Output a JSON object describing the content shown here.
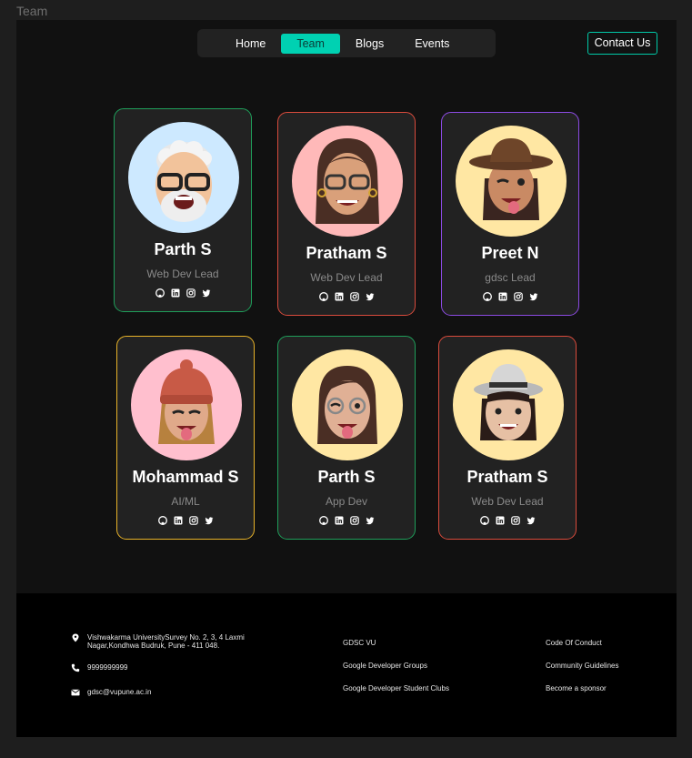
{
  "frame_label": "Team",
  "nav": {
    "items": [
      {
        "label": "Home",
        "active": false
      },
      {
        "label": "Team",
        "active": true
      },
      {
        "label": "Blogs",
        "active": false
      },
      {
        "label": "Events",
        "active": false
      }
    ],
    "contact_label": "Contact Us"
  },
  "accent_color": "#00d1b2",
  "members": [
    {
      "name": "Parth S",
      "role": "Web Dev Lead",
      "border": "#1f9e5a",
      "avatar_bg": "#cde9ff"
    },
    {
      "name": "Pratham S",
      "role": "Web Dev Lead",
      "border": "#d94b3c",
      "avatar_bg": "#ffb9b9"
    },
    {
      "name": "Preet N",
      "role": "gdsc Lead",
      "border": "#8c4be3",
      "avatar_bg": "#ffe7a3"
    },
    {
      "name": "Mohammad S",
      "role": "AI/ML",
      "border": "#e8b329",
      "avatar_bg": "#ffbfce"
    },
    {
      "name": "Parth S",
      "role": "App Dev",
      "border": "#1f9e5a",
      "avatar_bg": "#ffe7a3"
    },
    {
      "name": "Pratham S",
      "role": "Web Dev Lead",
      "border": "#d94b3c",
      "avatar_bg": "#ffe7a3"
    }
  ],
  "socials": [
    "github-icon",
    "linkedin-icon",
    "instagram-icon",
    "twitter-icon"
  ],
  "footer": {
    "address": "Vishwakarma UniversitySurvey No. 2, 3, 4 Laxmi Nagar,Kondhwa Budruk, Pune - 411 048.",
    "phone": "9999999999",
    "email": "gdsc@vupune.ac.in",
    "links_middle": [
      "GDSC VU",
      "Google Developer Groups",
      "Google Developer Student Clubs"
    ],
    "links_right": [
      "Code Of Conduct",
      "Community Guidelines",
      "Become a sponsor"
    ]
  }
}
